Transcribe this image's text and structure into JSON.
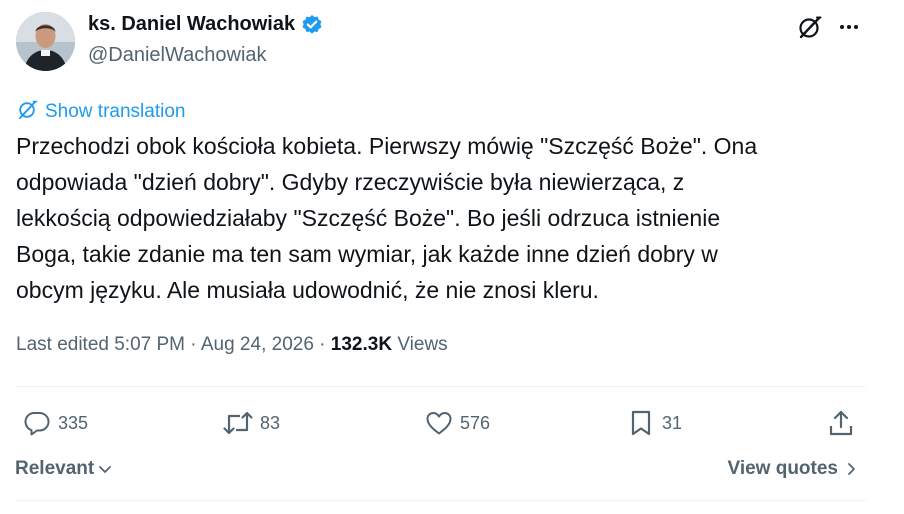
{
  "author": {
    "name": "ks. Daniel Wachowiak",
    "handle": "@DanielWachowiak",
    "verified": true
  },
  "translation": {
    "label": "Show translation"
  },
  "tweet": {
    "text": "Przechodzi obok kościoła kobieta. Pierwszy mówię \"Szczęść Boże\". Ona\nodpowiada \"dzień dobry\". Gdyby rzeczywiście była niewierząca, z\nlekkością odpowiedziałaby \"Szczęść Boże\". Bo jeśli odrzuca istnienie\nBoga, takie zdanie ma ten sam wymiar, jak każde inne dzień dobry w\nobcym języku. Ale musiała udowodnić, że nie znosi kleru."
  },
  "meta": {
    "edited_label": "Last edited 5:07 PM",
    "separator": " · ",
    "date": "Aug 24, 2026",
    "views_count": "132.3K",
    "views_label": "Views"
  },
  "actions": {
    "replies": "335",
    "reposts": "83",
    "likes": "576",
    "bookmarks": "31"
  },
  "footer": {
    "sort_label": "Relevant",
    "view_quotes_label": "View quotes"
  },
  "colors": {
    "accent": "#1d9bf0",
    "text_primary": "#0f1419",
    "text_secondary": "#536471",
    "divider": "#eff3f4"
  },
  "icons": {
    "grok": "grok-icon",
    "more": "more-icon",
    "translate": "translate-icon",
    "reply": "reply-icon",
    "repost": "repost-icon",
    "like": "heart-icon",
    "bookmark": "bookmark-icon",
    "share": "share-icon",
    "sort_chevron": "chevron-down-icon",
    "quotes_chevron": "chevron-right-icon",
    "verified": "verified-badge-icon"
  }
}
